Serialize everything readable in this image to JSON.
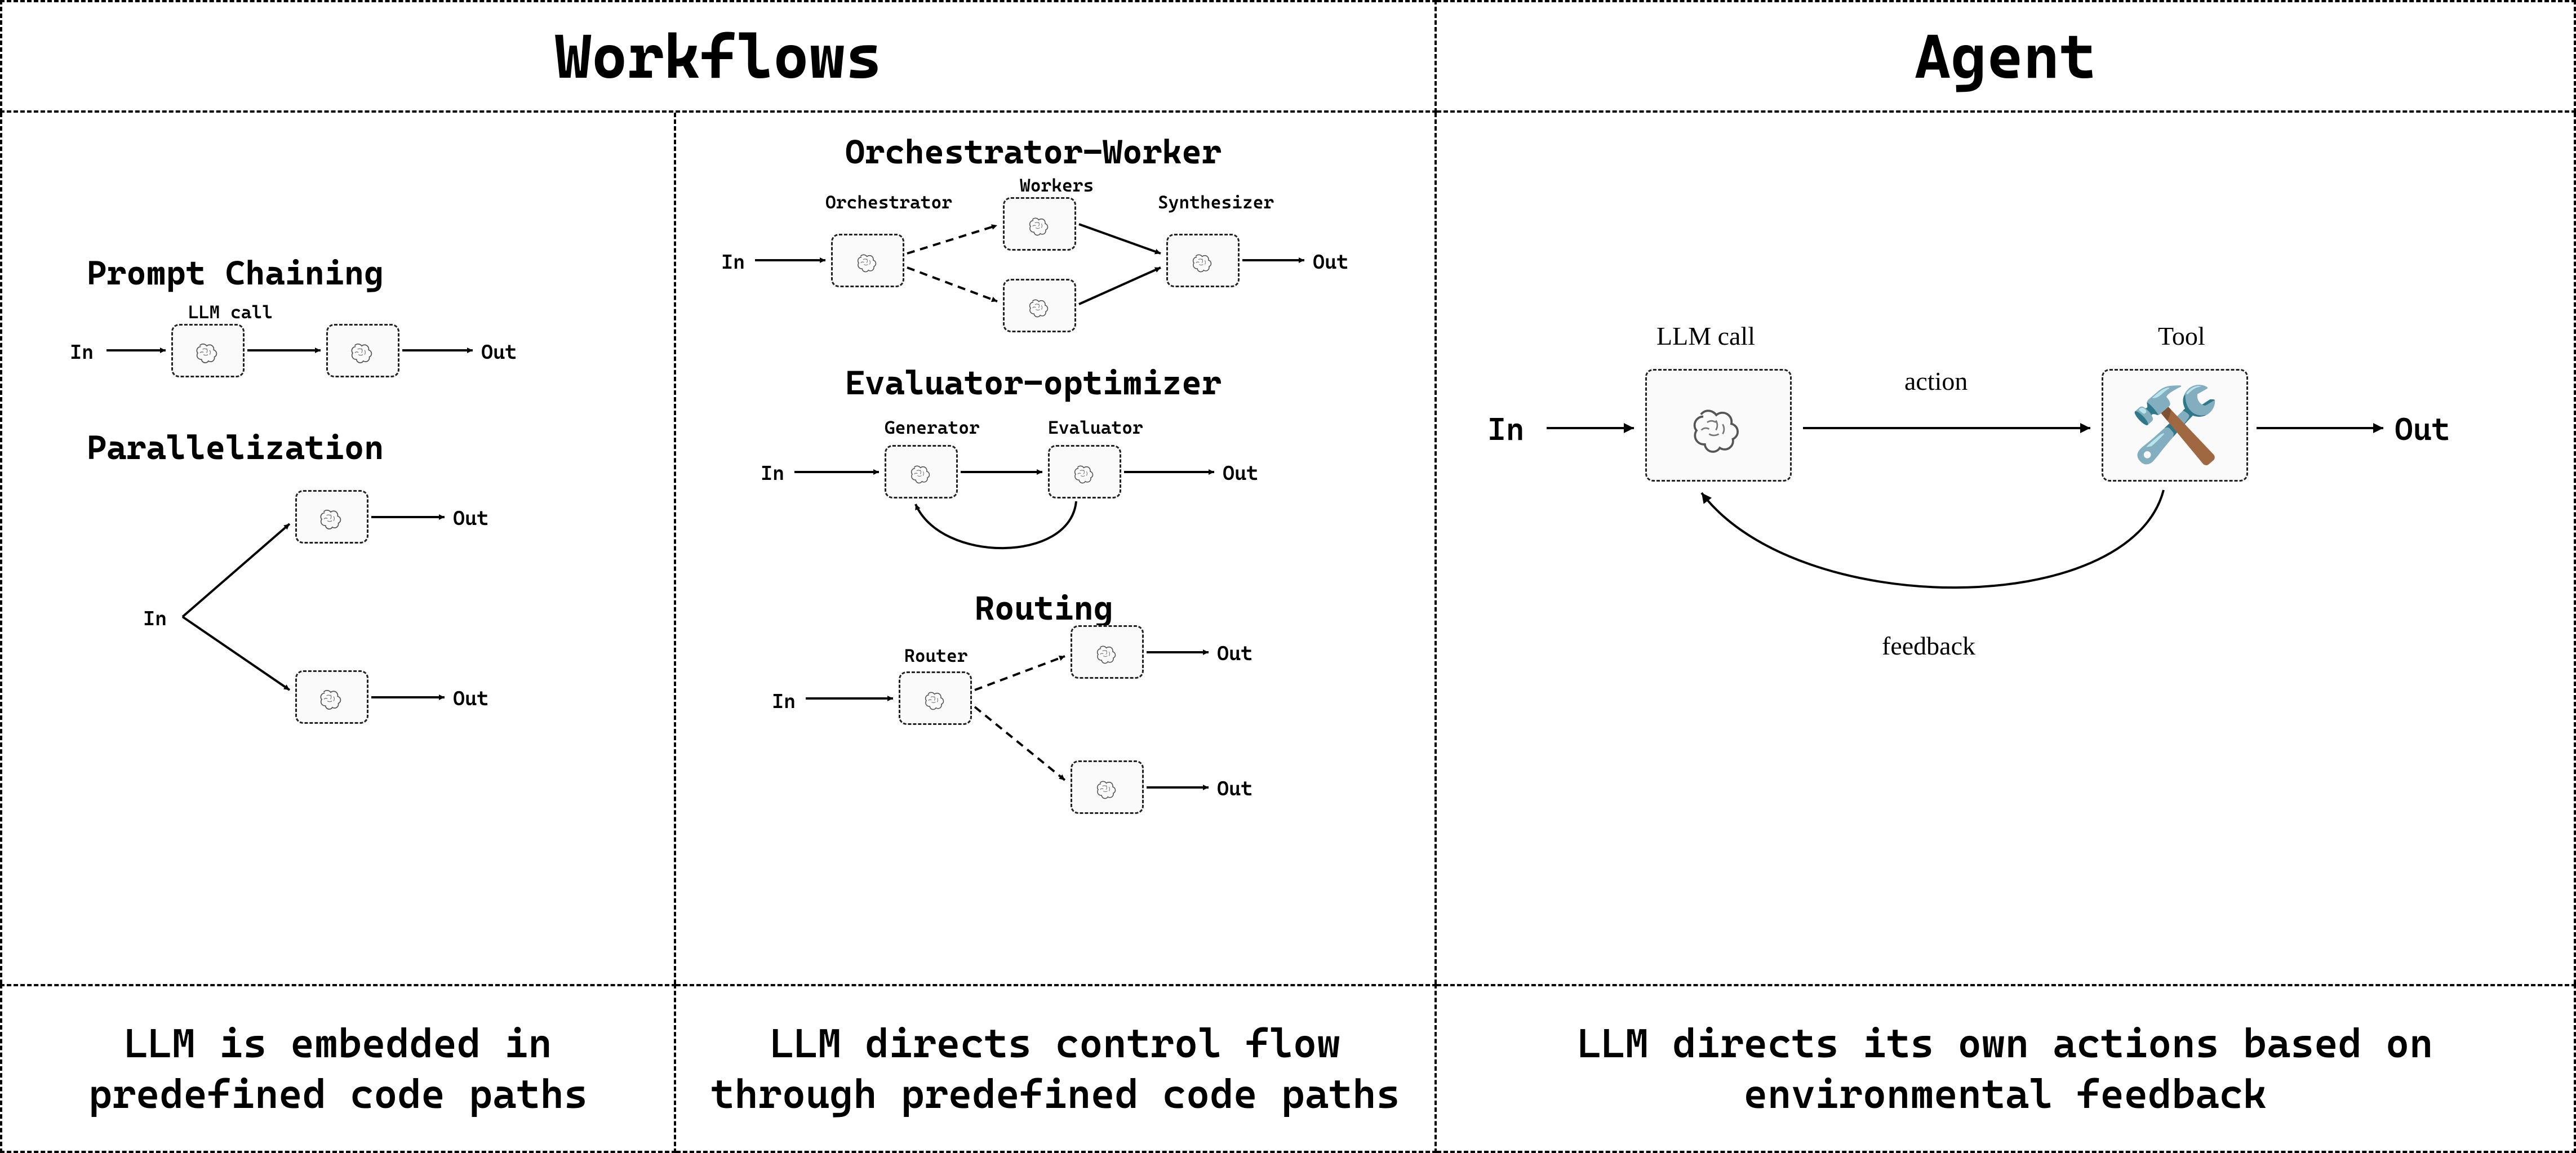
{
  "headers": {
    "workflows": "Workflows",
    "agent": "Agent"
  },
  "footers": {
    "a": "LLM is embedded in predefined code paths",
    "b": "LLM directs control flow through predefined code paths",
    "c": "LLM directs its own actions based on environmental feedback"
  },
  "io": {
    "in": "In",
    "out": "Out"
  },
  "colA": {
    "promptChaining": {
      "title": "Prompt Chaining",
      "nodeLabel": "LLM call"
    },
    "parallelization": {
      "title": "Parallelization"
    }
  },
  "colB": {
    "orchWorker": {
      "title": "Orchestrator-Worker",
      "orchestrator": "Orchestrator",
      "workers": "Workers",
      "synthesizer": "Synthesizer"
    },
    "evalOpt": {
      "title": "Evaluator-optimizer",
      "generator": "Generator",
      "evaluator": "Evaluator"
    },
    "routing": {
      "title": "Routing",
      "router": "Router"
    }
  },
  "colC": {
    "llmCall": "LLM call",
    "tool": "Tool",
    "action": "action",
    "feedback": "feedback"
  }
}
